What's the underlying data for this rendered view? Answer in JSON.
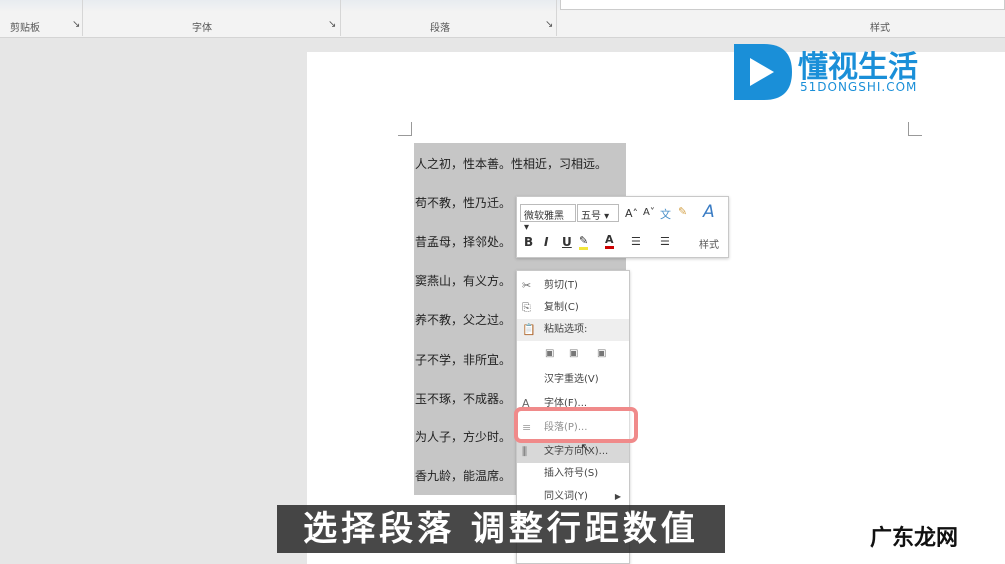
{
  "ribbon": {
    "groups": [
      "剪贴板",
      "字体",
      "段落",
      "样式"
    ]
  },
  "document": {
    "lines": [
      "人之初，性本善。性相近，习相远。",
      "苟不教，性乃迁。",
      "昔孟母，择邻处。",
      "窦燕山，有义方。",
      "养不教，父之过。",
      "子不学，非所宜。",
      "玉不琢，不成器。",
      "为人子，方少时。",
      "香九龄，能温席。"
    ]
  },
  "mini_toolbar": {
    "font": "微软雅黑",
    "size": "五号",
    "bold": "B",
    "italic": "I",
    "underline": "U",
    "styles": "样式"
  },
  "context_menu": {
    "items": [
      "剪切(T)",
      "复制(C)",
      "粘贴选项:",
      "汉字重选(V)",
      "字体(F)...",
      "段落(P)...",
      "文字方向(X)...",
      "插入符号(S)",
      "同义词(Y)"
    ]
  },
  "subtitle": "选择段落 调整行距数值",
  "logo": {
    "name": "懂视生活",
    "site": "51DONGSHI.COM"
  },
  "watermark": "广东龙网",
  "colors": {
    "accent": "#1a8fd8",
    "highlight": "#f08a8a"
  }
}
